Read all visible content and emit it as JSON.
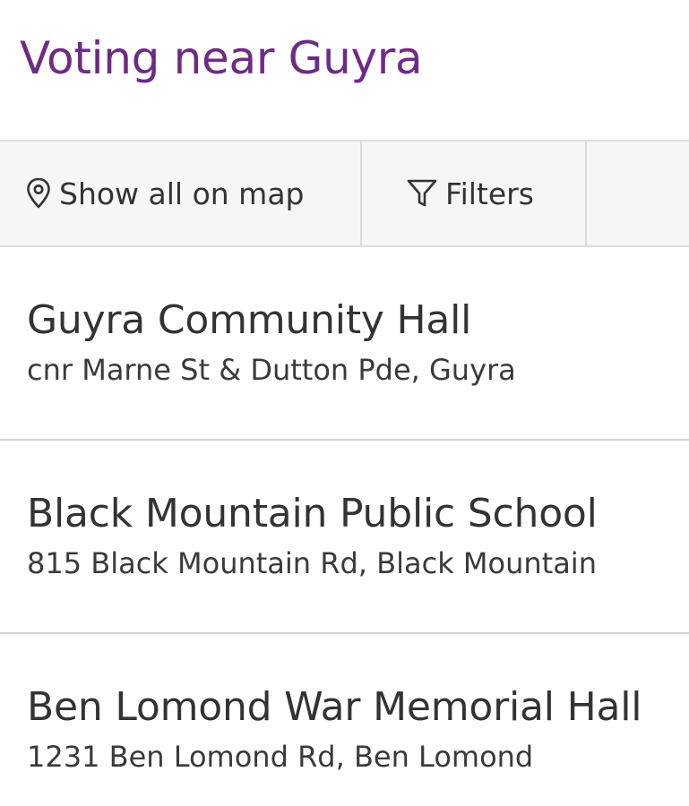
{
  "header": {
    "title": "Voting near Guyra"
  },
  "toolbar": {
    "show_all_on_map": {
      "label": "Show all on map",
      "icon": "map-pin-icon"
    },
    "filters": {
      "label": "Filters",
      "icon": "filter-icon"
    }
  },
  "results": [
    {
      "name": "Guyra Community Hall",
      "address": "cnr Marne St & Dutton Pde, Guyra"
    },
    {
      "name": "Black Mountain Public School",
      "address": "815 Black Mountain Rd, Black Mountain"
    },
    {
      "name": "Ben Lomond War Memorial Hall",
      "address": "1231 Ben Lomond Rd, Ben Lomond"
    }
  ],
  "colors": {
    "title": "#6e2b86",
    "toolbar_bg": "#f5f6f7",
    "divider": "#dcdde0",
    "text": "#333333"
  }
}
